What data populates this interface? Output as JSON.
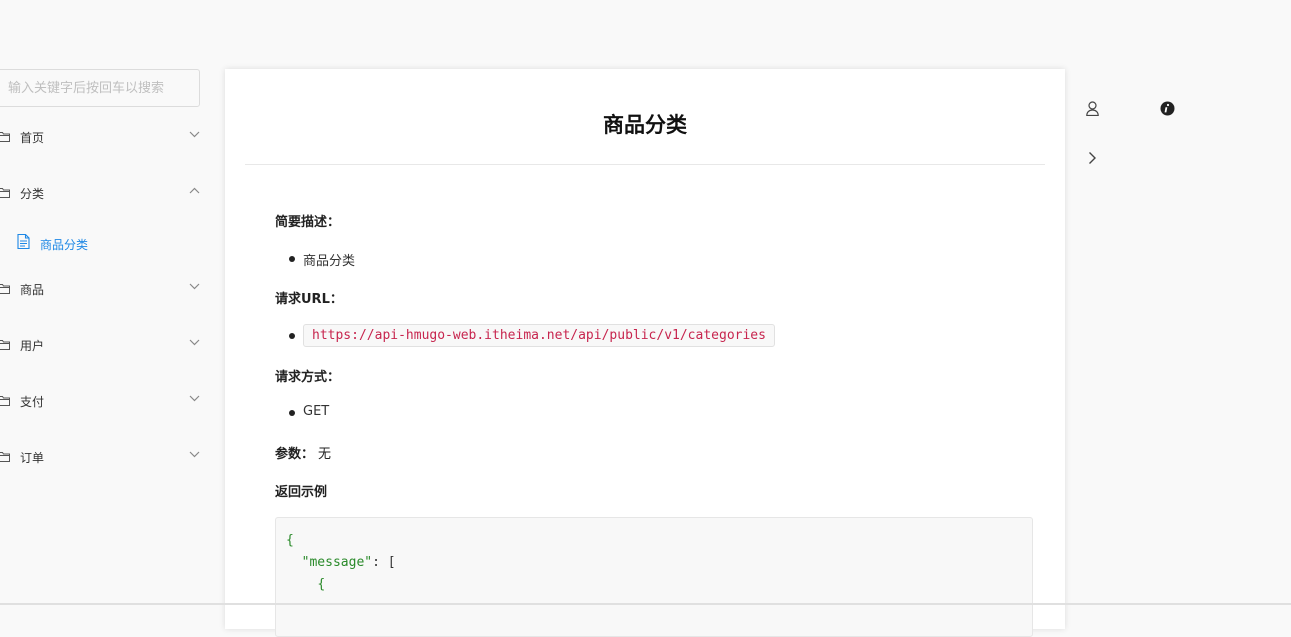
{
  "search": {
    "placeholder": "输入关键字后按回车以搜索"
  },
  "sidebar": {
    "items": [
      {
        "label": "首页",
        "expanded": false
      },
      {
        "label": "分类",
        "expanded": true
      },
      {
        "label": "商品",
        "expanded": false
      },
      {
        "label": "用户",
        "expanded": false
      },
      {
        "label": "支付",
        "expanded": false
      },
      {
        "label": "订单",
        "expanded": false
      }
    ],
    "sub_items": [
      {
        "label": "商品分类",
        "active": true
      }
    ]
  },
  "page": {
    "title": "商品分类",
    "desc_heading": "简要描述：",
    "desc_item": "商品分类",
    "url_heading": "请求URL：",
    "url": "https://api-hmugo-web.itheima.net/api/public/v1/categories",
    "method_heading": "请求方式：",
    "method": "GET",
    "params_heading": "参数：",
    "params_value": "无",
    "example_heading": "返回示例",
    "code_line1": "{",
    "code_line2_key": "\"message\"",
    "code_line2_rest": ": [",
    "code_line3": "{"
  },
  "colors": {
    "accent": "#1e88e5",
    "code_red": "#c7254e",
    "code_green": "#2a8a2a"
  },
  "icons": [
    "folder-icon",
    "chevron-down-icon",
    "chevron-up-icon",
    "document-icon",
    "user-icon",
    "info-icon",
    "chevron-right-icon"
  ]
}
